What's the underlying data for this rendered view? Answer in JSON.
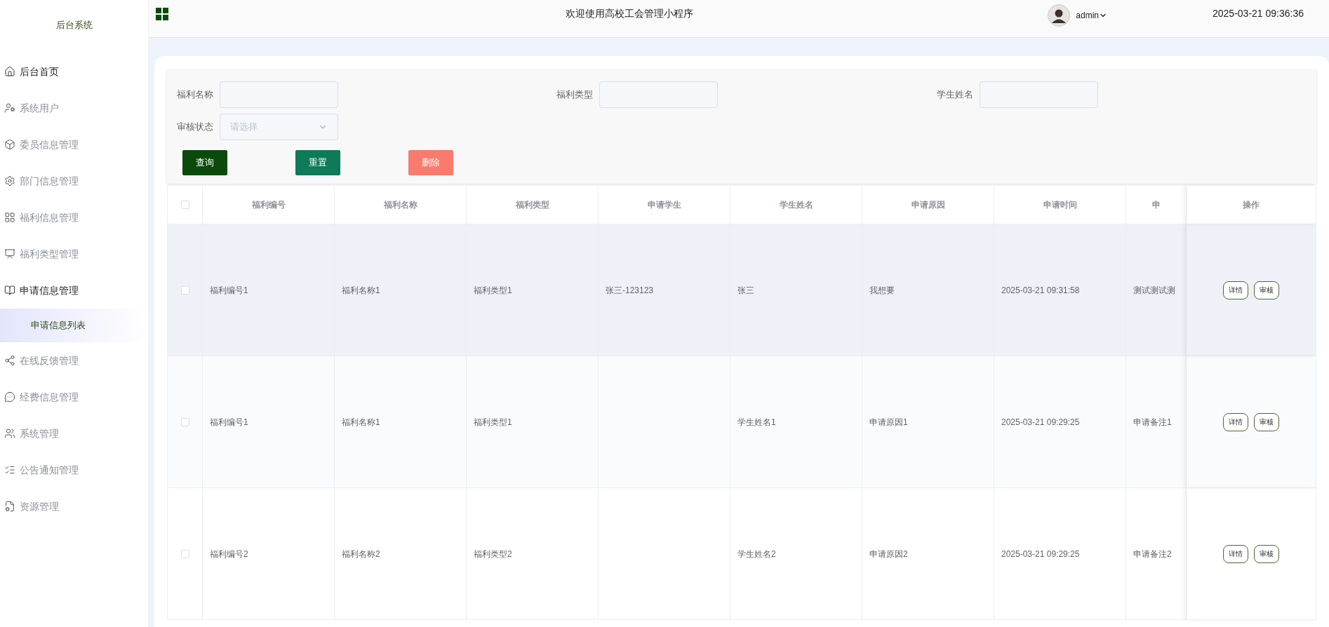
{
  "sidebar": {
    "title": "后台系统",
    "items": [
      {
        "label": "后台首页",
        "active": true
      },
      {
        "label": "系统用户",
        "active": false
      },
      {
        "label": "委员信息管理",
        "active": false
      },
      {
        "label": "部门信息管理",
        "active": false
      },
      {
        "label": "福利信息管理",
        "active": false
      },
      {
        "label": "福利类型管理",
        "active": false
      },
      {
        "label": "申请信息管理",
        "active": true,
        "children": [
          {
            "label": "申请信息列表",
            "selected": true
          }
        ]
      },
      {
        "label": "在线反馈管理",
        "active": false
      },
      {
        "label": "经费信息管理",
        "active": false
      },
      {
        "label": "系统管理",
        "active": false
      },
      {
        "label": "公告通知管理",
        "active": false
      },
      {
        "label": "资源管理",
        "active": false
      }
    ]
  },
  "header": {
    "title": "欢迎使用高校工会管理小程序",
    "user": "admin",
    "datetime": "2025-03-21 09:36:36"
  },
  "filters": {
    "fields": [
      {
        "label": "福利名称",
        "kind": "text"
      },
      {
        "label": "福利类型",
        "kind": "text"
      },
      {
        "label": "学生姓名",
        "kind": "text"
      },
      {
        "label": "审核状态",
        "kind": "select",
        "placeholder": "请选择"
      }
    ],
    "buttons": [
      {
        "label": "查询",
        "kind": "search"
      },
      {
        "label": "重置",
        "kind": "reset"
      },
      {
        "label": "删除",
        "kind": "delete"
      }
    ]
  },
  "table": {
    "select_all_checked": false,
    "columns": [
      "福利编号",
      "福利名称",
      "福利类型",
      "申请学生",
      "学生姓名",
      "申请原因",
      "申请时间",
      "申"
    ],
    "action_column": "操作",
    "rows": [
      {
        "checked": false,
        "highlighted": true,
        "welfare_no": "福利编号1",
        "welfare_name": "福利名称1",
        "welfare_type": "福利类型1",
        "applicant": "张三-123123",
        "student_name": "张三",
        "reason": "我想要",
        "time": "2025-03-21 09:31:58",
        "note": "测试测试测",
        "actions": [
          "详情",
          "审核"
        ]
      },
      {
        "checked": false,
        "highlighted": false,
        "welfare_no": "福利编号1",
        "welfare_name": "福利名称1",
        "welfare_type": "福利类型1",
        "student_name": "学生姓名1",
        "reason": "申请原因1",
        "time": "2025-03-21 09:29:25",
        "note": "申请备注1",
        "actions": [
          "详情",
          "审核"
        ]
      },
      {
        "checked": false,
        "highlighted": false,
        "welfare_no": "福利编号2",
        "welfare_name": "福利名称2",
        "welfare_type": "福利类型2",
        "student_name": "学生姓名2",
        "reason": "申请原因2",
        "time": "2025-03-21 09:29:25",
        "note": "申请备注2",
        "actions": [
          "详情",
          "审核"
        ]
      }
    ]
  }
}
